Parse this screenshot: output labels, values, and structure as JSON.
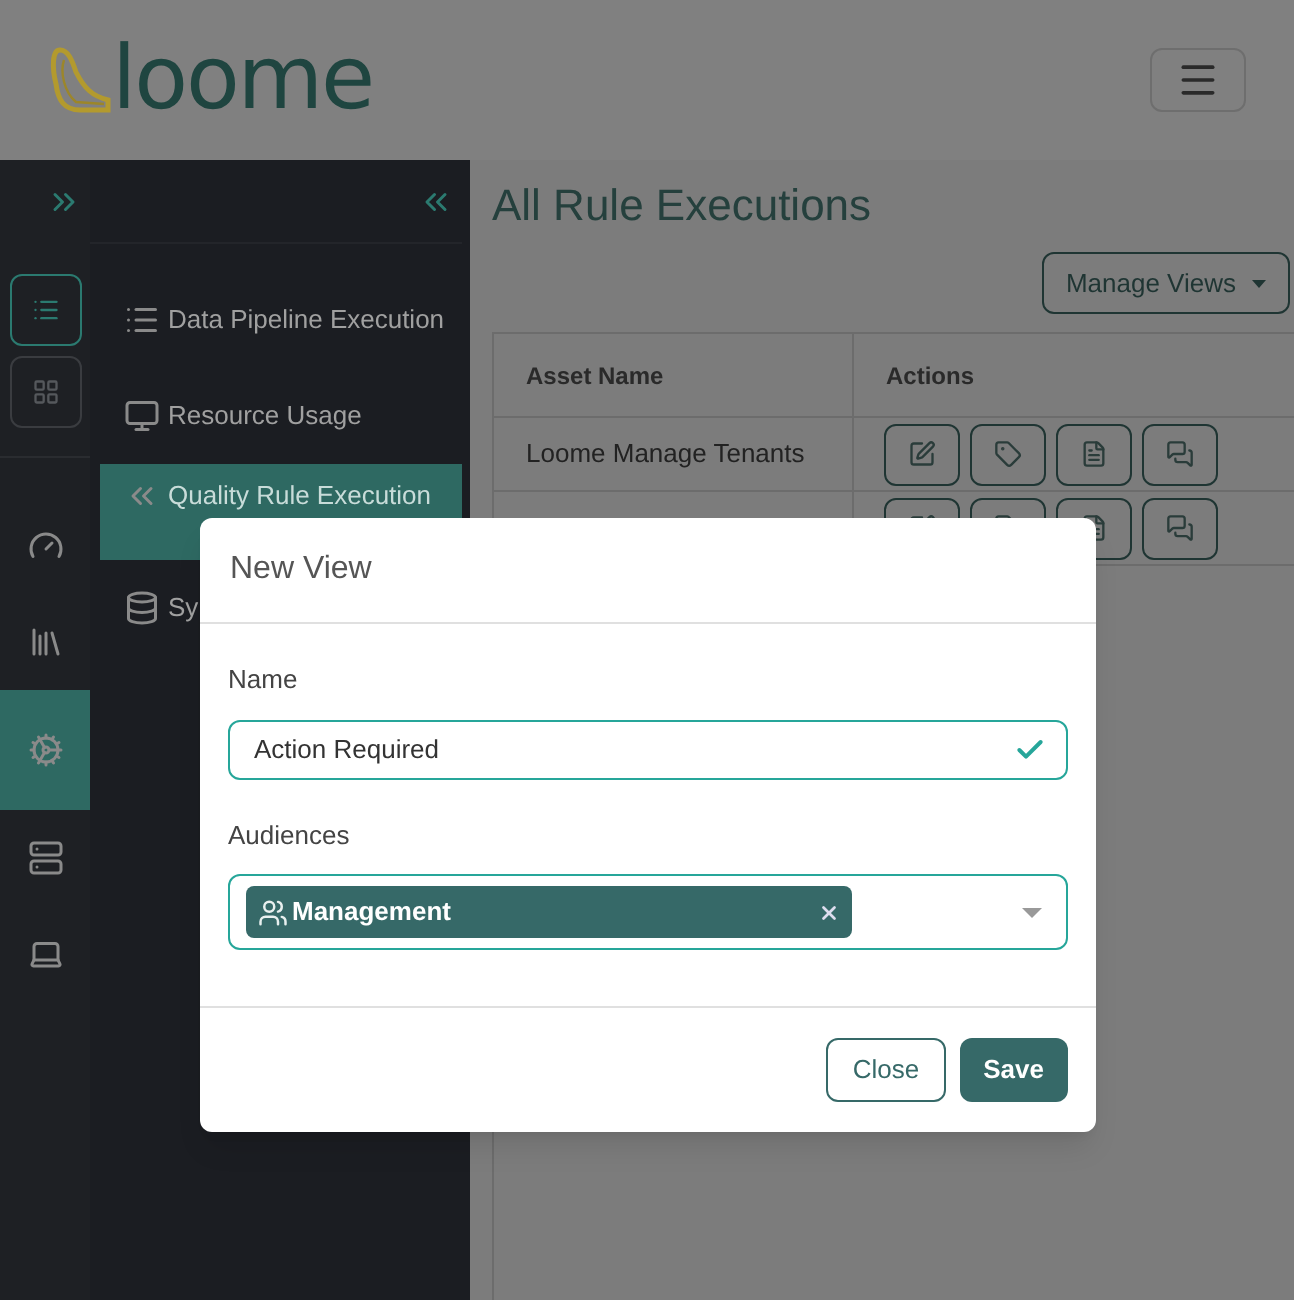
{
  "header": {
    "logo_text": "loome"
  },
  "rail": {
    "tools": [
      {
        "selected": true
      },
      {
        "selected": false
      }
    ],
    "nav": [
      {
        "selected": false
      },
      {
        "selected": false
      },
      {
        "selected": true
      },
      {
        "selected": false
      },
      {
        "selected": false
      }
    ]
  },
  "panel": {
    "items": [
      {
        "label": "Data Pipeline Execution",
        "selected": false
      },
      {
        "label": "Resource Usage",
        "selected": false
      },
      {
        "label": "Quality Rule Execution",
        "selected": true
      },
      {
        "label": "Sy",
        "selected": false
      }
    ]
  },
  "page": {
    "title": "All Rule Executions",
    "manage_views": "Manage Views"
  },
  "table": {
    "columns": [
      "Asset Name",
      "Actions"
    ],
    "rows": [
      {
        "asset_name": "Loome Manage Tenants"
      },
      {}
    ]
  },
  "dialog": {
    "title": "New View",
    "name_label": "Name",
    "name_value": "Action Required",
    "name_valid": true,
    "audiences_label": "Audiences",
    "chips": [
      {
        "label": "Management"
      }
    ],
    "buttons": [
      {
        "label": "Close",
        "kind": "outline"
      },
      {
        "label": "Save",
        "kind": "primary"
      }
    ]
  }
}
